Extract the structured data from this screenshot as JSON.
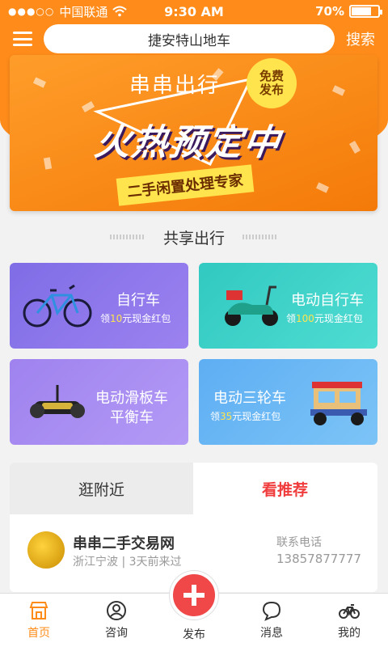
{
  "status_bar": {
    "carrier": "中国联通",
    "signal_dots": "●●●○○",
    "time": "9:30 AM",
    "battery": "70%",
    "battery_level": 0.7
  },
  "header": {
    "search_text": "捷安特山地车",
    "search_button": "搜索",
    "menu_icon": "menu-icon"
  },
  "banner": {
    "brand": "串串出行",
    "badge_line1": "免费",
    "badge_line2": "发布",
    "headline": "火热预定中",
    "slogan": "二手闲置处理专家"
  },
  "section": {
    "title": "共享出行"
  },
  "categories": [
    {
      "title": "自行车",
      "sub_prefix": "领",
      "amount": "10",
      "sub_suffix": "元现金红包",
      "color": "#8a6fe8",
      "icon": "bicycle-icon"
    },
    {
      "title": "电动自行车",
      "sub_prefix": "领",
      "amount": "100",
      "sub_suffix": "元现金红包",
      "color": "#3ed0c8",
      "icon": "scooter-icon"
    },
    {
      "title": "电动滑板车",
      "title2": "平衡车",
      "color": "#a98af0",
      "icon": "hoverboard-icon"
    },
    {
      "title": "电动三轮车",
      "sub_prefix": "领",
      "amount": "35",
      "sub_suffix": "元现金红包",
      "color": "#6ab6f5",
      "icon": "tricycle-icon"
    }
  ],
  "tabs": [
    {
      "label": "逛附近"
    },
    {
      "label": "看推荐"
    }
  ],
  "listing": {
    "name": "串串二手交易网",
    "location": "浙江宁波",
    "time": "3天前来过",
    "contact_label": "联系电话",
    "phone": "13857877777"
  },
  "bottom_nav": [
    {
      "label": "首页",
      "icon": "home-icon"
    },
    {
      "label": "咨询",
      "icon": "user-icon"
    },
    {
      "label": "发布",
      "icon": "plus-icon"
    },
    {
      "label": "消息",
      "icon": "message-icon"
    },
    {
      "label": "我的",
      "icon": "bike-icon"
    }
  ],
  "colors": {
    "accent": "#ff8c1a",
    "publish": "#f04848",
    "recommend_tab": "#f03c3c"
  }
}
